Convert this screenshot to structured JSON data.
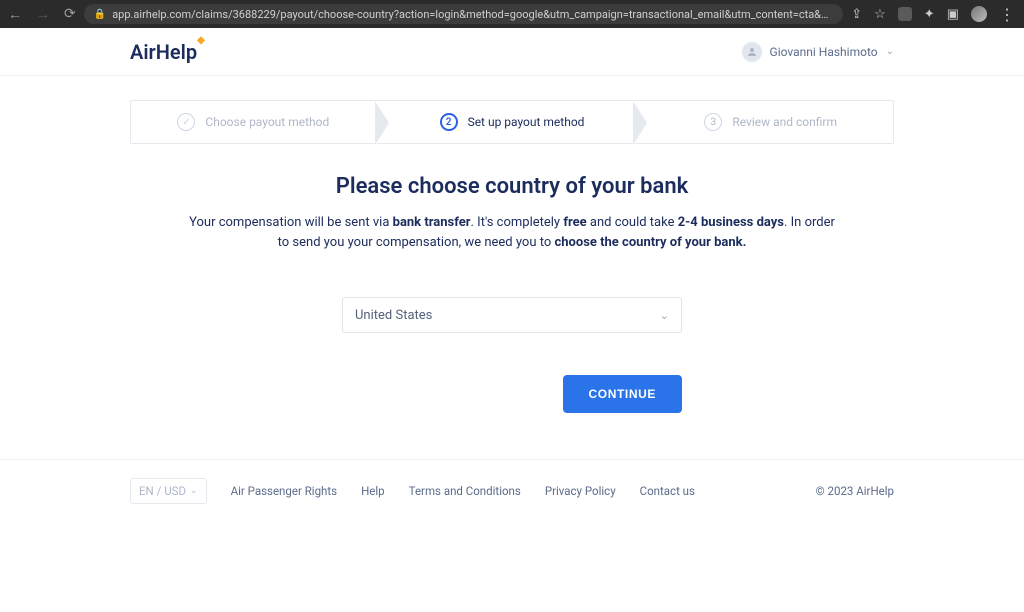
{
  "browser": {
    "url": "app.airhelp.com/claims/3688229/payout/choose-country?action=login&method=google&utm_campaign=transactional_email&utm_content=cta&utm..."
  },
  "header": {
    "logo_text": "AirHelp",
    "user_name": "Giovanni Hashimoto"
  },
  "stepper": {
    "step1": {
      "label": "Choose payout method"
    },
    "step2": {
      "num": "2",
      "label": "Set up payout method"
    },
    "step3": {
      "num": "3",
      "label": "Review and confirm"
    }
  },
  "main": {
    "title": "Please choose country of your bank",
    "desc_part1": "Your compensation will be sent via ",
    "desc_bold1": "bank transfer",
    "desc_part2": ". It's completely ",
    "desc_bold2": "free",
    "desc_part3": " and could take ",
    "desc_bold3": "2-4 business days",
    "desc_part4": ". In order to send you your compensation, we need you to ",
    "desc_bold4": "choose the country of your bank."
  },
  "form": {
    "country_selected": "United States",
    "continue_label": "CONTINUE"
  },
  "footer": {
    "lang": "EN / USD",
    "links": {
      "rights": "Air Passenger Rights",
      "help": "Help",
      "terms": "Terms and Conditions",
      "privacy": "Privacy Policy",
      "contact": "Contact us"
    },
    "copyright": "© 2023 AirHelp"
  }
}
